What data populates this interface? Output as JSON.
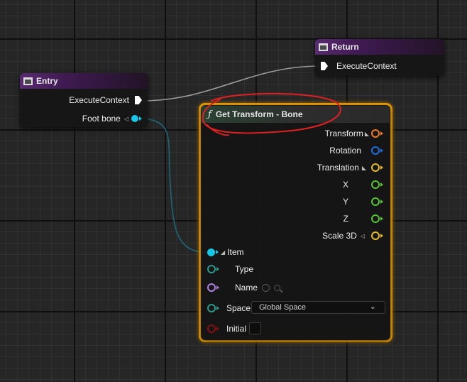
{
  "colors": {
    "exec": "#ffffff",
    "bone_pin": "#15c7e6",
    "transform_pin": "#ee7a22",
    "rotation_pin": "#1d6fe0",
    "vector_pin": "#e8b922",
    "float_pin": "#55c530",
    "name_pin": "#b080e0",
    "type_pin": "#2a9a8e",
    "bool_pin": "#8a1010",
    "selection_outline": "#f0a000",
    "annotation": "#e02020"
  },
  "entry_node": {
    "title": "Entry",
    "execute_context": "ExecuteContext",
    "foot_bone": "Foot bone"
  },
  "return_node": {
    "title": "Return",
    "execute_context": "ExecuteContext"
  },
  "get_transform_node": {
    "function_icon": "ƒ",
    "title": "Get Transform - Bone",
    "outputs": {
      "transform": "Transform",
      "rotation": "Rotation",
      "translation": "Translation",
      "x": "X",
      "y": "Y",
      "z": "Z",
      "scale_3d": "Scale 3D"
    },
    "inputs": {
      "item": "Item",
      "type": "Type",
      "name": "Name",
      "space": "Space",
      "space_value": "Global Space",
      "initial": "Initial"
    }
  }
}
